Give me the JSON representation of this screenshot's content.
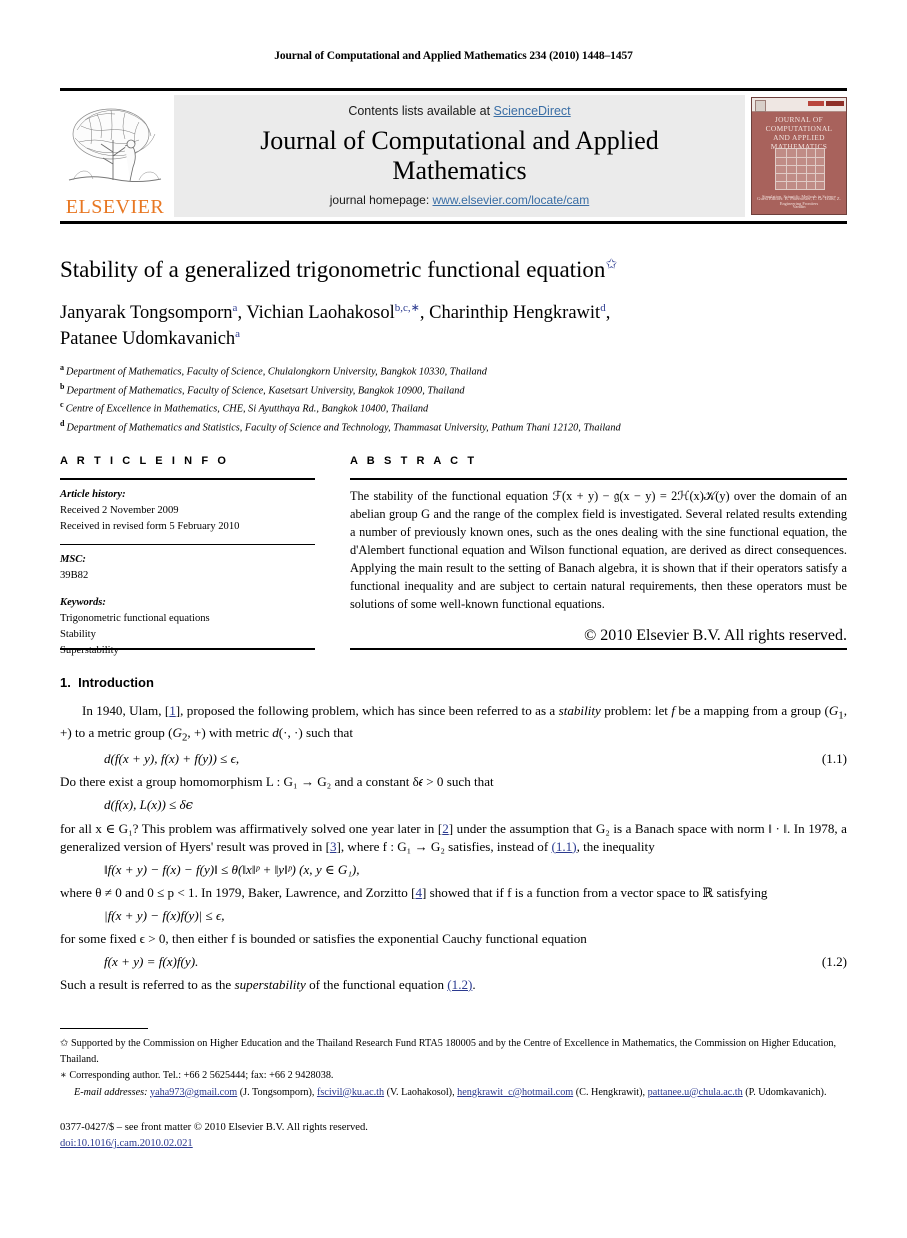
{
  "running_head": "Journal of Computational and Applied Mathematics 234 (2010) 1448–1457",
  "masthead": {
    "contents_prefix": "Contents lists available at ",
    "sciencedirect": "ScienceDirect",
    "journal_name_line1": "Journal of Computational and Applied",
    "journal_name_line2": "Mathematics",
    "homepage_prefix": "journal homepage: ",
    "homepage_url": "www.elsevier.com/locate/cam",
    "publisher": "ELSEVIER",
    "cover": {
      "title": "JOURNAL OF COMPUTATIONAL AND APPLIED MATHEMATICS",
      "subtitle": "Simulation, Scientific Methods in Science Engineering Frontiers",
      "editors": "Guest Editors: B. Paternoster, L. Gr. Ixaru, Z. Vandin",
      "publisher_mark": "ELSEVIER"
    },
    "accent_link_color": "#3a6ea5"
  },
  "title": {
    "text": "Stability of a generalized trigonometric functional equation",
    "footnote_mark": "✩"
  },
  "authors": [
    {
      "name": "Janyarak Tongsomporn",
      "marks": "a"
    },
    {
      "name": "Vichian Laohakosol",
      "marks": "b,c,∗"
    },
    {
      "name": "Charinthip Hengkrawit",
      "marks": "d"
    },
    {
      "name": "Patanee Udomkavanich",
      "marks": "a"
    }
  ],
  "affiliations": [
    {
      "mark": "a",
      "text": "Department of Mathematics, Faculty of Science, Chulalongkorn University, Bangkok 10330, Thailand"
    },
    {
      "mark": "b",
      "text": "Department of Mathematics, Faculty of Science, Kasetsart University, Bangkok 10900, Thailand"
    },
    {
      "mark": "c",
      "text": "Centre of Excellence in Mathematics, CHE, Si Ayutthaya Rd., Bangkok 10400, Thailand"
    },
    {
      "mark": "d",
      "text": "Department of Mathematics and Statistics, Faculty of Science and Technology, Thammasat University, Pathum Thani 12120, Thailand"
    }
  ],
  "article_info": {
    "heading": "A R T I C L E    I N F O",
    "history_label": "Article history:",
    "history_lines": [
      "Received 2 November 2009",
      "Received in revised form 5 February 2010"
    ],
    "msc_label": "MSC:",
    "msc_value": "39B82",
    "keywords_label": "Keywords:",
    "keywords": [
      "Trigonometric functional equations",
      "Stability",
      "Superstability"
    ]
  },
  "abstract": {
    "heading": "A B S T R A C T",
    "text": "The stability of the functional equation ℱ(x + y) − 𝔤(x − y) = 2ℋ(x)𝒦(y) over the domain of an abelian group G and the range of the complex field is investigated. Several related results extending a number of previously known ones, such as the ones dealing with the sine functional equation, the d'Alembert functional equation and Wilson functional equation, are derived as direct consequences. Applying the main result to the setting of Banach algebra, it is shown that if their operators satisfy a functional inequality and are subject to certain natural requirements, then these operators must be solutions of some well-known functional equations.",
    "copyright": "© 2010 Elsevier B.V. All rights reserved."
  },
  "body": {
    "section_number": "1.",
    "section_title": "Introduction",
    "para1_a": "In 1940, Ulam, [",
    "para1_ref1": "1",
    "para1_b": "], proposed the following problem, which has since been referred to as a ",
    "para1_stability": "stability",
    "para1_c": " problem: let f be a mapping from a group (G",
    "para1_d": ", +) to a metric group (G",
    "para1_e": ", +) with metric d(·, ·) such that",
    "eq_1_1": "d(f(x + y), f(x) + f(y)) ≤ ϵ,",
    "eq_1_1_num": "(1.1)",
    "para2": "Do there exist a group homomorphism L : G₁ → G₂ and a constant δ𝜖 > 0 such that",
    "eq_unnum_1": "d(f(x), L(x)) ≤ δ𝜖",
    "para3_a": "for all x ∈ G₁? This problem was affirmatively solved one year later in [",
    "para3_ref2": "2",
    "para3_b": "] under the assumption that G₂ is a Banach space with norm ‖ · ‖. In 1978, a generalized version of Hyers' result was proved in [",
    "para3_ref3": "3",
    "para3_c": "], where f : G₁ → G₂ satisfies, instead of ",
    "para3_ref11": "(1.1)",
    "para3_d": ", the inequality",
    "eq_unnum_2": "‖f(x + y) − f(x) − f(y)‖ ≤ θ(‖x‖ᵖ + ‖y‖ᵖ)   (x, y ∈ G₁),",
    "para4_a": "where θ ≠ 0 and 0 ≤ p < 1. In 1979, Baker, Lawrence, and Zorzitto [",
    "para4_ref4": "4",
    "para4_b": "] showed that if f is a function from a vector space to ℝ satisfying",
    "eq_unnum_3": "|f(x + y) − f(x)f(y)| ≤ ϵ,",
    "para5": "for some fixed ϵ > 0, then either f is bounded or satisfies the exponential Cauchy functional equation",
    "eq_1_2": "f(x + y) = f(x)f(y).",
    "eq_1_2_num": "(1.2)",
    "para6_a": "Such a result is referred to as the ",
    "para6_superstability": "superstability",
    "para6_b": " of the functional equation ",
    "para6_ref12": "(1.2)",
    "para6_c": "."
  },
  "footnotes": {
    "star_mark": "✩",
    "star_text": "Supported by the Commission on Higher Education and the Thailand Research Fund RTA5 180005 and by the Centre of Excellence in Mathematics, the Commission on Higher Education, Thailand.",
    "corr_mark": "∗",
    "corr_text": "Corresponding author. Tel.: +66 2 5625444; fax: +66 2 9428038.",
    "email_label": "E-mail addresses:",
    "emails": [
      {
        "address": "yaha973@gmail.com",
        "owner": "(J. Tongsomporn)"
      },
      {
        "address": "fscivil@ku.ac.th",
        "owner": "(V. Laohakosol)"
      },
      {
        "address": "hengkrawit_c@hotmail.com",
        "owner": "(C. Hengkrawit)"
      },
      {
        "address": "pattanee.u@chula.ac.th",
        "owner": "(P. Udomkavanich)"
      }
    ]
  },
  "colophon": {
    "issn_line": "0377-0427/$ – see front matter © 2010 Elsevier B.V. All rights reserved.",
    "doi": "doi:10.1016/j.cam.2010.02.021"
  }
}
